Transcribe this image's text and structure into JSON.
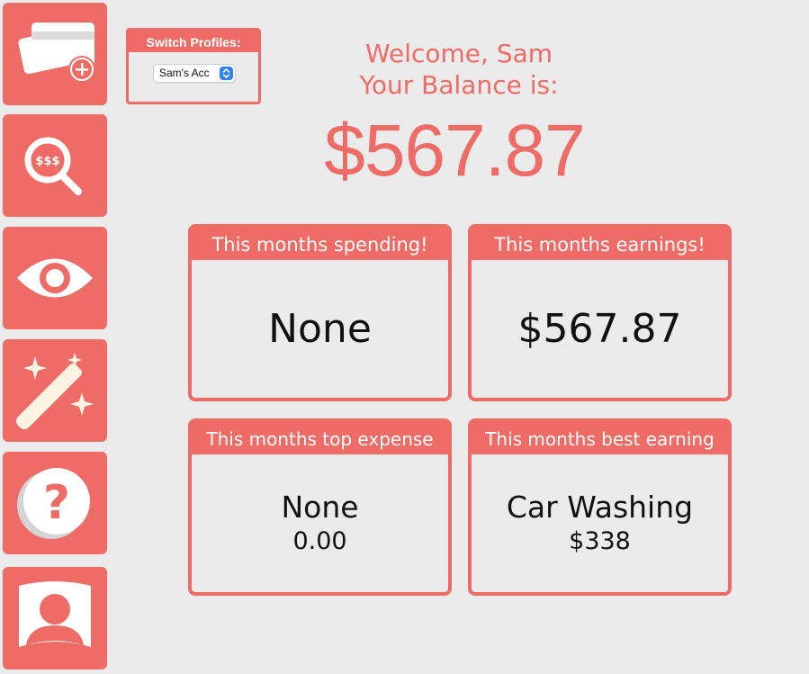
{
  "sidebar": {
    "items": [
      {
        "icon": "add-card-icon"
      },
      {
        "icon": "search-money-icon",
        "icon_text": "$$$"
      },
      {
        "icon": "eye-icon"
      },
      {
        "icon": "magic-wand-icon"
      },
      {
        "icon": "help-icon",
        "icon_text": "?"
      },
      {
        "icon": "profile-icon"
      }
    ]
  },
  "profile": {
    "title": "Switch Profiles:",
    "selected": "Sam's Acc"
  },
  "header": {
    "welcome": "Welcome, Sam",
    "balance_label": "Your Balance is:",
    "balance": "$567.87"
  },
  "cards": {
    "spending": {
      "title": "This months spending!",
      "value": "None"
    },
    "earnings": {
      "title": "This months earnings!",
      "value": "$567.87"
    },
    "top_expense": {
      "title": "This months top expense",
      "value": "None",
      "amount": "0.00"
    },
    "best_earning": {
      "title": "This months best earning",
      "value": "Car Washing",
      "amount": "$338"
    }
  },
  "colors": {
    "accent": "#ef6b65",
    "background": "#ebebeb",
    "icon_fill": "#ffffff",
    "wand_fill": "#fbf3e3"
  }
}
